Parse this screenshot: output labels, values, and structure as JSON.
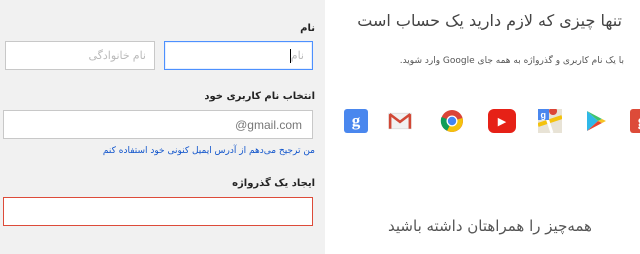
{
  "form": {
    "name_label": "نام",
    "first_name": {
      "placeholder": "نام",
      "value": ""
    },
    "last_name": {
      "placeholder": "نام خانوادگی",
      "value": ""
    },
    "username_label": "انتخاب نام کاربری خود",
    "username": {
      "value": "",
      "suffix": "@gmail.com"
    },
    "use_current_email_link": "من ترجیح می‌دهم از آدرس ایمیل کنونی خود استفاده کنم",
    "password_label": "ایجاد یک گذرواژه",
    "password": {
      "value": ""
    }
  },
  "promo": {
    "headline": "تنها چیزی که لازم دارید یک حساب است",
    "subline": "با یک نام کاربری و گذرواژه به همه جای Google وارد شوید.",
    "tagline": "همه‌چیز را همراهتان داشته باشید",
    "products": [
      {
        "name": "google-search-icon",
        "color": "#4a87ee",
        "glyph": "g"
      },
      {
        "name": "gmail-icon",
        "color": "#d14836",
        "glyph": "M"
      },
      {
        "name": "chrome-icon",
        "color": "#e9b325",
        "glyph": ""
      },
      {
        "name": "youtube-icon",
        "color": "#e62117",
        "glyph": "▶"
      },
      {
        "name": "maps-icon",
        "color": "#3f9b4a",
        "glyph": "g"
      },
      {
        "name": "play-store-icon",
        "color": "#2fb8e8",
        "glyph": "▶"
      },
      {
        "name": "google-plus-icon",
        "color": "#dd4b39",
        "glyph": "g"
      }
    ]
  },
  "colors": {
    "form_bg": "#f1f1f1",
    "focus_border": "#4d90fe",
    "error_border": "#dd4b39",
    "link": "#1155cc"
  }
}
